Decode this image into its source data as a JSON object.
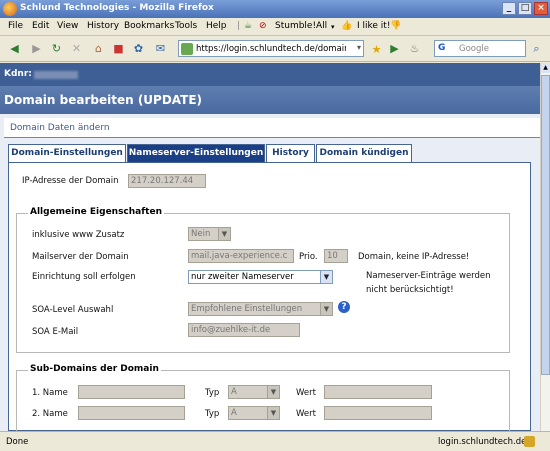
{
  "window": {
    "title": "Schlund Technologies - Mozilla Firefox",
    "minimize": "_",
    "maximize": "□",
    "close": "×"
  },
  "menu": [
    "File",
    "Edit",
    "View",
    "History",
    "Bookmarks",
    "Tools",
    "Help"
  ],
  "toolbar": {
    "stumble": "Stumble!",
    "all": "All",
    "ilike": "I like it!"
  },
  "nav": {
    "url": "https://login.schlundtech.de/domain/upda",
    "search_placeholder": "Google",
    "search_engine": "G"
  },
  "page": {
    "kdnr_label": "Kdnr:",
    "title": "Domain bearbeiten (UPDATE)",
    "subheader": "Domain Daten ändern",
    "tabs": [
      {
        "label": "Domain-Einstellungen",
        "active": false
      },
      {
        "label": "Nameserver-Einstellungen",
        "active": true
      },
      {
        "label": "History",
        "active": false
      },
      {
        "label": "Domain kündigen",
        "active": false
      }
    ],
    "ip_label": "IP-Adresse der Domain",
    "ip_value": "217.20.127.44",
    "general": {
      "legend": "Allgemeine Eigenschaften",
      "www_label": "inklusive www Zusatz",
      "www_value": "Nein",
      "mx_label": "Mailserver der Domain",
      "mx_value": "mail.java-experience.c",
      "prio_label": "Prio.",
      "prio_value": "10",
      "mx_note": "Domain, keine IP-Adresse!",
      "setup_label": "Einrichtung soll erfolgen",
      "setup_value": "nur zweiter Nameserver",
      "setup_note_1": "Nameserver-Einträge werden",
      "setup_note_2": "nicht berücksichtigt!",
      "soa_level_label": "SOA-Level Auswahl",
      "soa_level_value": "Empfohlene Einstellungen",
      "soa_email_label": "SOA E-Mail",
      "soa_email_value": "info@zuehlke-it.de"
    },
    "subdomains": {
      "legend": "Sub-Domains der Domain",
      "rows": [
        {
          "name_label": "1. Name",
          "typ_label": "Typ",
          "typ_value": "A",
          "wert_label": "Wert"
        },
        {
          "name_label": "2. Name",
          "typ_label": "Typ",
          "typ_value": "A",
          "wert_label": "Wert"
        }
      ]
    }
  },
  "status": {
    "left": "Done",
    "right": "login.schlundtech.de"
  }
}
